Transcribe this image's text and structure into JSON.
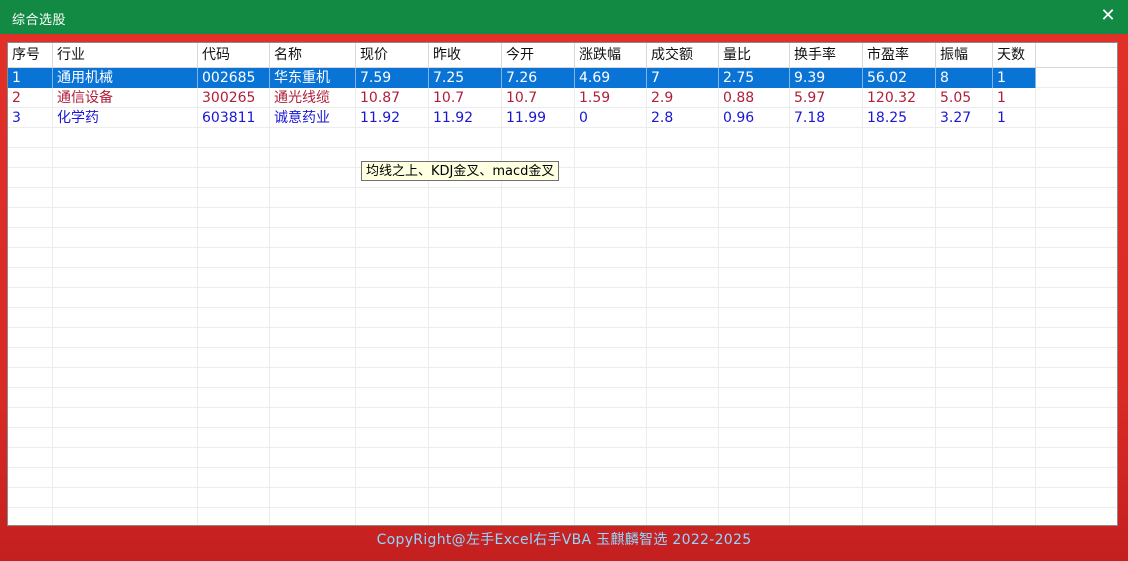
{
  "window": {
    "title": "综合选股",
    "close_glyph": "✕"
  },
  "table": {
    "columns": [
      "序号",
      "行业",
      "代码",
      "名称",
      "现价",
      "昨收",
      "今开",
      "涨跌幅",
      "成交额",
      "量比",
      "换手率",
      "市盈率",
      "振幅",
      "天数"
    ],
    "rows": [
      {
        "selected": true,
        "color": "#ffffff",
        "cells": [
          "1",
          "通用机械",
          "002685",
          "华东重机",
          "7.59",
          "7.25",
          "7.26",
          "4.69",
          "7",
          "2.75",
          "9.39",
          "56.02",
          "8",
          "1"
        ]
      },
      {
        "selected": false,
        "color": "#b0203a",
        "cells": [
          "2",
          "通信设备",
          "300265",
          "通光线缆",
          "10.87",
          "10.7",
          "10.7",
          "1.59",
          "2.9",
          "0.88",
          "5.97",
          "120.32",
          "5.05",
          "1"
        ]
      },
      {
        "selected": false,
        "color": "#1a16d6",
        "cells": [
          "3",
          "化学药",
          "603811",
          "诚意药业",
          "11.92",
          "11.92",
          "11.99",
          "0",
          "2.8",
          "0.96",
          "7.18",
          "18.25",
          "3.27",
          "1"
        ]
      }
    ]
  },
  "tooltip": "均线之上、KDJ金叉、macd金叉",
  "footer": "CopyRight@左手Excel右手VBA 玉麒麟智选  2022-2025",
  "colors": {
    "titlebar": "#138a43",
    "frame": "#e23128",
    "selection": "#0a74d6",
    "footer_text": "#8fd7ff"
  }
}
